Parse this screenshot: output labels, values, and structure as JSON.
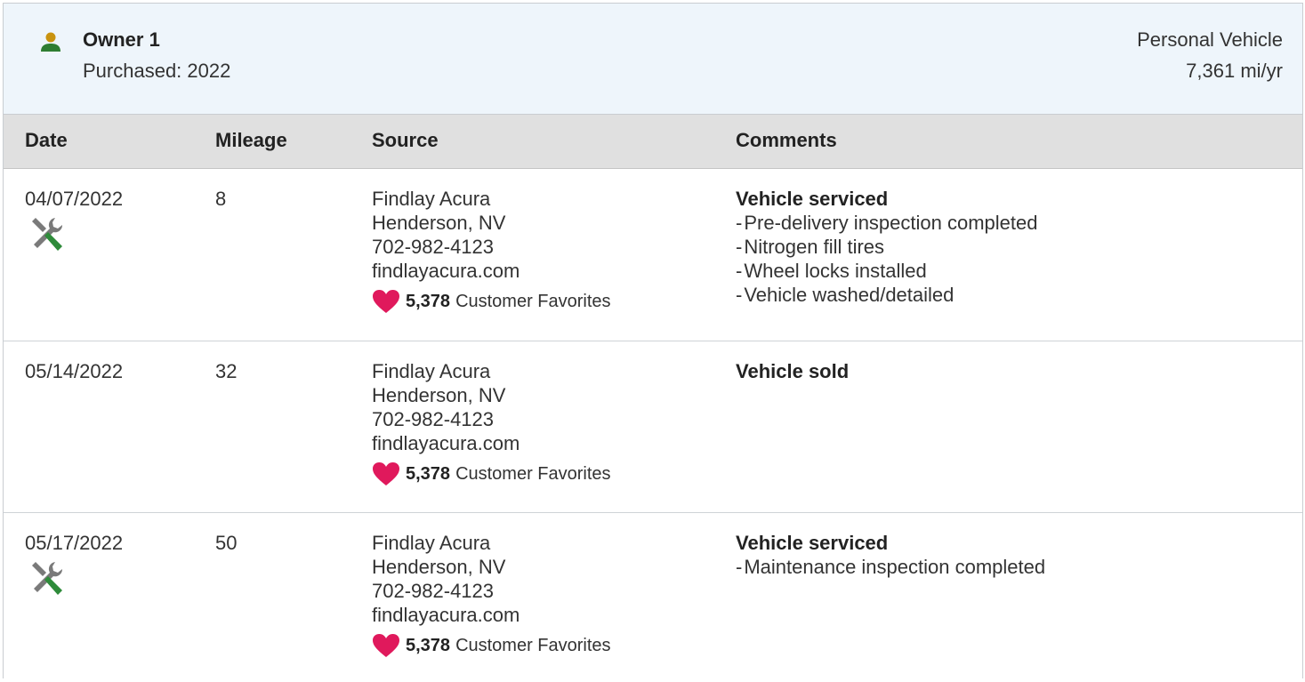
{
  "owner": {
    "title": "Owner 1",
    "purchased": "Purchased: 2022",
    "usage": "Personal Vehicle",
    "rate": "7,361 mi/yr",
    "icon": "person-icon"
  },
  "table": {
    "columns": [
      "Date",
      "Mileage",
      "Source",
      "Comments"
    ],
    "rows": [
      {
        "date": "04/07/2022",
        "mileage": "8",
        "source_name": "Findlay Acura",
        "source_location": "Henderson, NV",
        "source_phone": "702-982-4123",
        "source_site": "findlayacura.com",
        "favorites_count": "5,378",
        "favorites_label": "Customer Favorites",
        "comment_title": "Vehicle serviced",
        "comment_items": [
          "Pre-delivery inspection completed",
          "Nitrogen fill tires",
          "Wheel locks installed",
          "Vehicle washed/detailed"
        ]
      },
      {
        "date": "05/14/2022",
        "mileage": "32",
        "source_name": "Findlay Acura",
        "source_location": "Henderson, NV",
        "source_phone": "702-982-4123",
        "source_site": "findlayacura.com",
        "favorites_count": "5,378",
        "favorites_label": "Customer Favorites",
        "comment_title": "Vehicle sold",
        "comment_items": []
      },
      {
        "date": "05/17/2022",
        "mileage": "50",
        "source_name": "Findlay Acura",
        "source_location": "Henderson, NV",
        "source_phone": "702-982-4123",
        "source_site": "findlayacura.com",
        "favorites_count": "5,378",
        "favorites_label": "Customer Favorites",
        "comment_title": "Vehicle serviced",
        "comment_items": [
          "Maintenance inspection completed"
        ]
      }
    ]
  },
  "colors": {
    "header_bg": "#eef5fb",
    "table_head_bg": "#e0e0e0",
    "heart": "#e0195c",
    "owner_icon_green": "#2e7d32",
    "owner_icon_gold": "#b8860b",
    "tool_grey": "#7a7a7a",
    "tool_green": "#2e8b3a"
  }
}
